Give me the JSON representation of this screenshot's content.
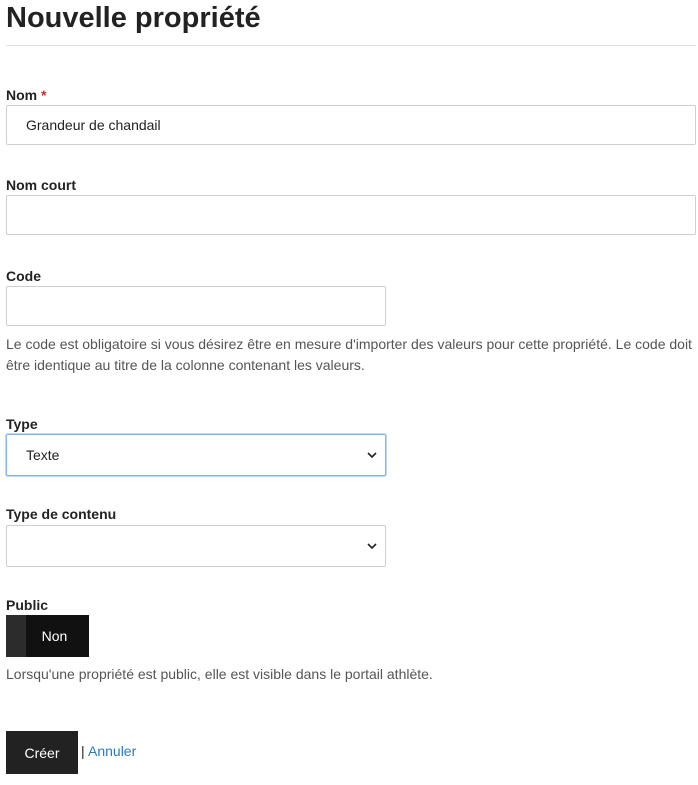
{
  "page": {
    "title": "Nouvelle propriété"
  },
  "form": {
    "nom": {
      "label": "Nom",
      "required_mark": "*",
      "value": "Grandeur de chandail"
    },
    "nom_court": {
      "label": "Nom court",
      "value": ""
    },
    "code": {
      "label": "Code",
      "value": "",
      "help": "Le code est obligatoire si vous désirez être en mesure d'importer des valeurs pour cette propriété. Le code doit être identique au titre de la colonne contenant les valeurs."
    },
    "type": {
      "label": "Type",
      "selected": "Texte"
    },
    "type_contenu": {
      "label": "Type de contenu",
      "selected": ""
    },
    "public": {
      "label": "Public",
      "toggle_text": "Non",
      "help": "Lorsqu'une propriété est public, elle est visible dans le portail athlète."
    }
  },
  "actions": {
    "create_label": "Créer",
    "separator": "|",
    "cancel_label": "Annuler"
  },
  "colors": {
    "link": "#2a7bc4",
    "button_bg": "#222222",
    "required": "#d9232d",
    "focus_border": "#86b6e8"
  }
}
